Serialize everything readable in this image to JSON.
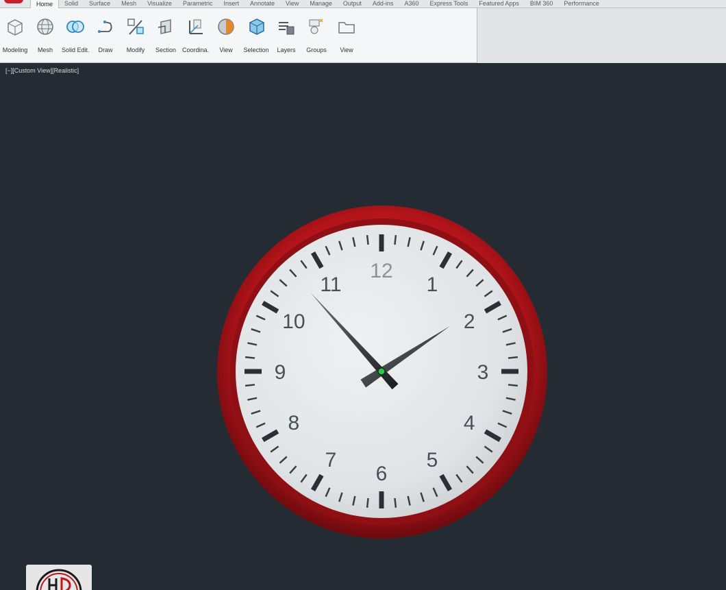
{
  "ribbon": {
    "tabs": [
      {
        "label": "Home",
        "active": true
      },
      {
        "label": "Solid"
      },
      {
        "label": "Surface"
      },
      {
        "label": "Mesh"
      },
      {
        "label": "Visualize"
      },
      {
        "label": "Parametric"
      },
      {
        "label": "Insert"
      },
      {
        "label": "Annotate"
      },
      {
        "label": "View"
      },
      {
        "label": "Manage"
      },
      {
        "label": "Output"
      },
      {
        "label": "Add-ins"
      },
      {
        "label": "A360"
      },
      {
        "label": "Express Tools"
      },
      {
        "label": "Featured Apps"
      },
      {
        "label": "BIM 360"
      },
      {
        "label": "Performance"
      }
    ],
    "panels": [
      {
        "label": "Modeling",
        "icon": "box-icon"
      },
      {
        "label": "Mesh",
        "icon": "mesh-sphere-icon"
      },
      {
        "label": "Solid Edit...",
        "icon": "union-icon"
      },
      {
        "label": "Draw",
        "icon": "polyline-icon"
      },
      {
        "label": "Modify",
        "icon": "modify-icon"
      },
      {
        "label": "Section",
        "icon": "section-plane-icon"
      },
      {
        "label": "Coordina...",
        "icon": "ucs-icon"
      },
      {
        "label": "View",
        "icon": "visual-style-icon"
      },
      {
        "label": "Selection",
        "icon": "selection-cube-icon"
      },
      {
        "label": "Layers",
        "icon": "layers-icon"
      },
      {
        "label": "Groups",
        "icon": "groups-icon"
      },
      {
        "label": "View",
        "icon": "folder-icon"
      }
    ]
  },
  "viewport": {
    "label": "[−][Custom View][Realistic]",
    "background": "#252b33"
  },
  "clock": {
    "numbers": [
      "12",
      "1",
      "2",
      "3",
      "4",
      "5",
      "6",
      "7",
      "8",
      "9",
      "10",
      "11"
    ],
    "time": "1:53",
    "rim_color": "#b3141a",
    "face_color": "#e6e8ea",
    "pivot_color": "#2cc84a"
  }
}
